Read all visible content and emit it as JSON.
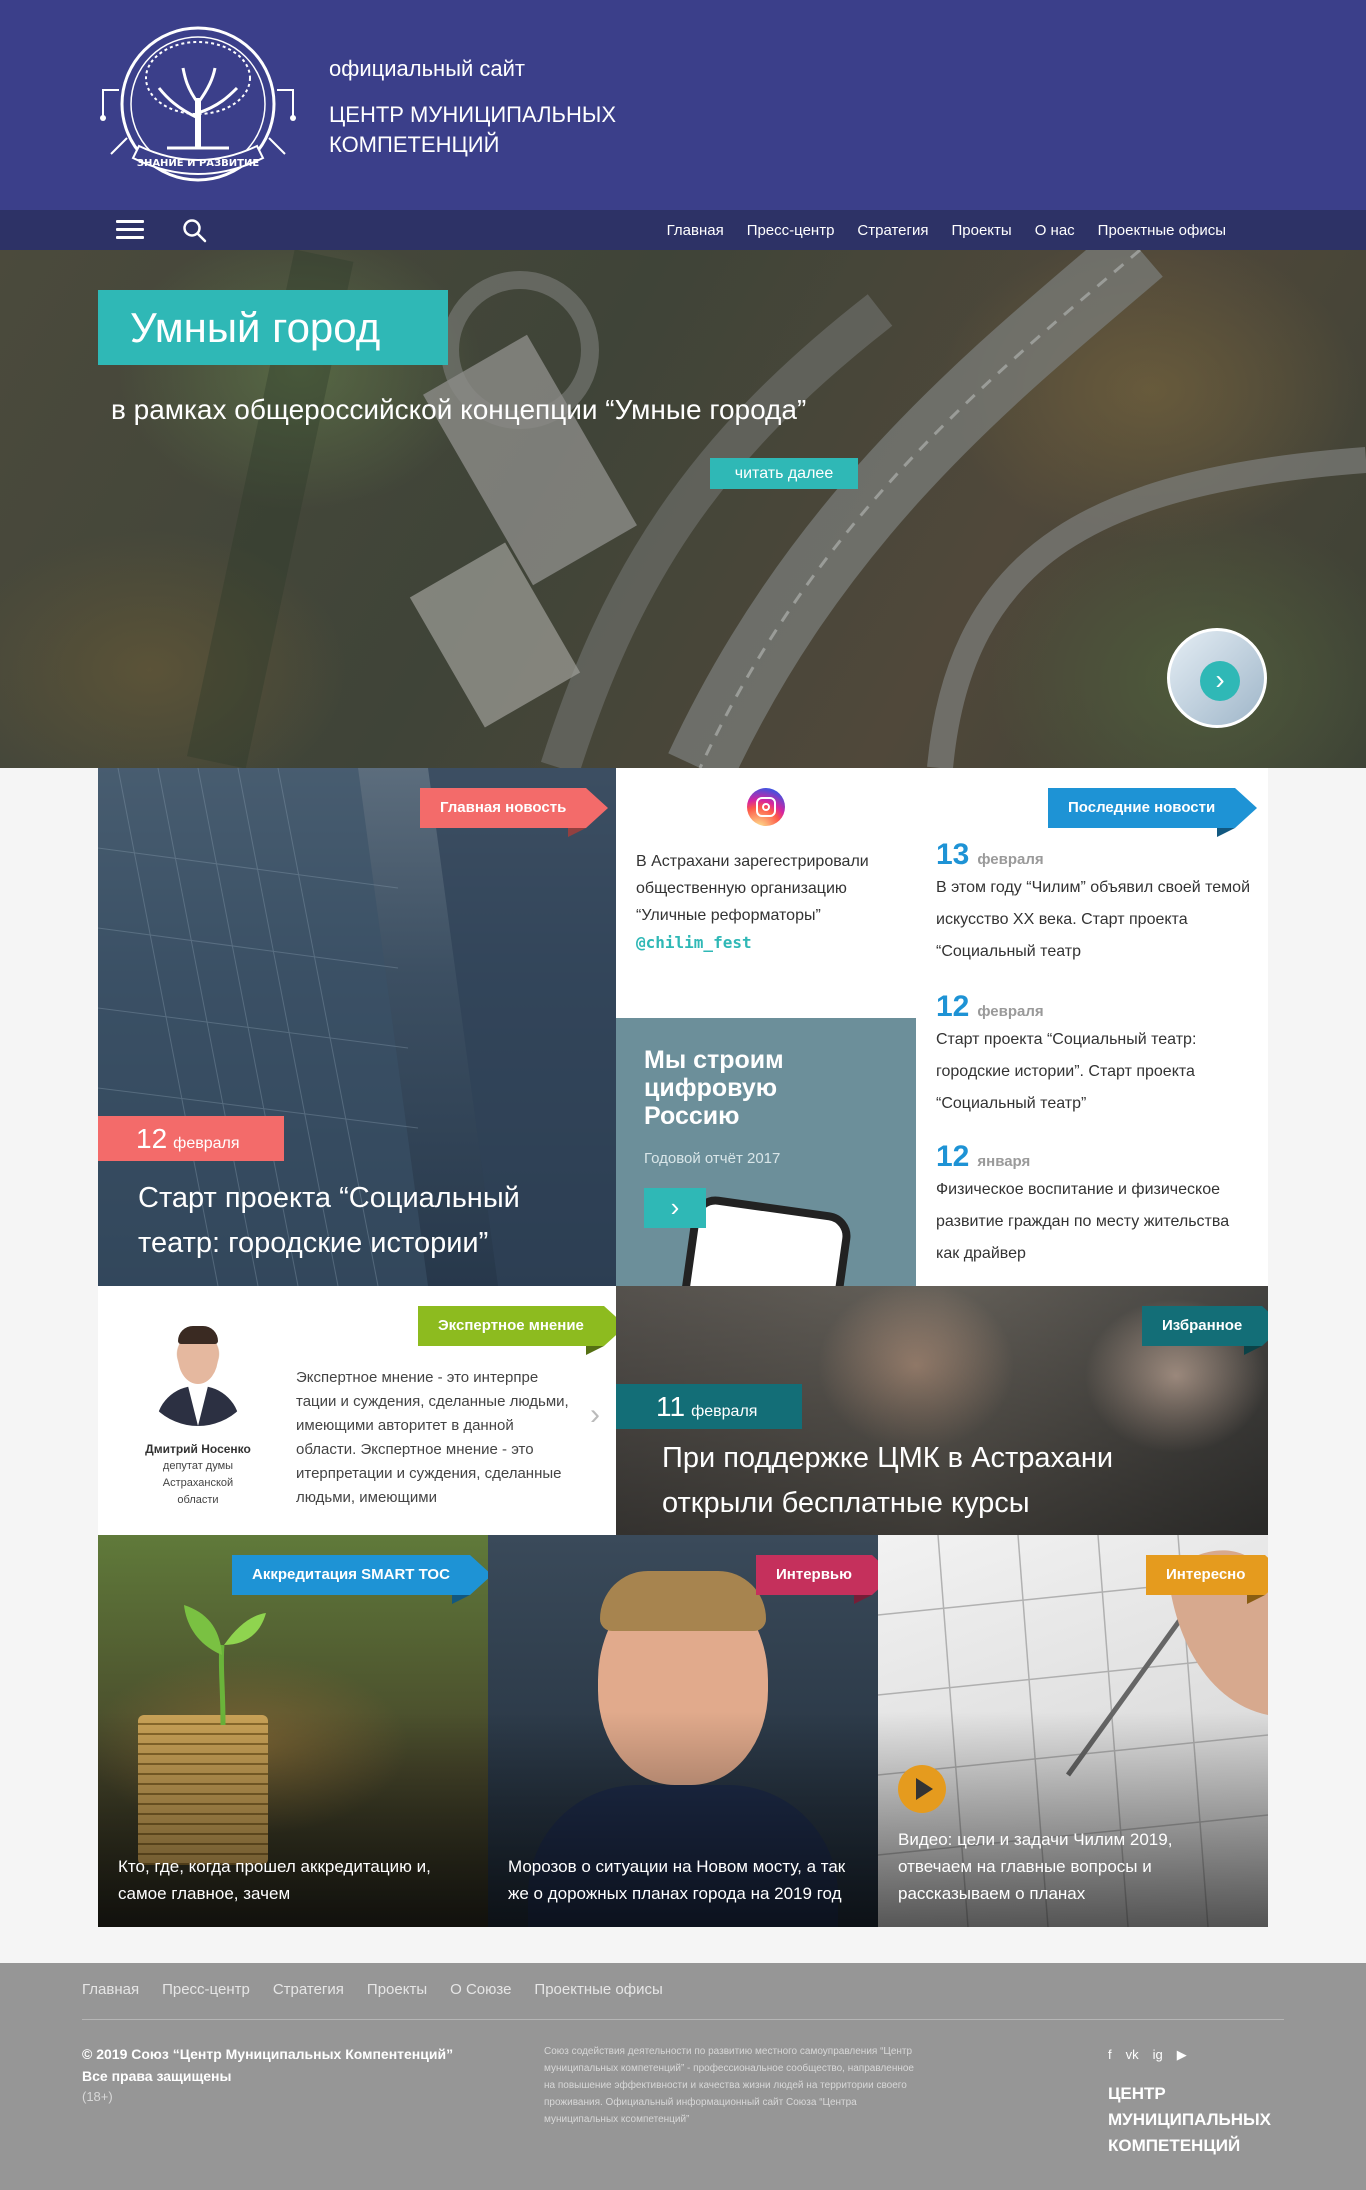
{
  "header": {
    "logo_text": "ЗНАНИЕ И РАЗВИТИЕ",
    "subtitle": "официальный сайт",
    "title": "ЦЕНТР МУНИЦИПАЛЬНЫХ КОМПЕТЕНЦИЙ"
  },
  "nav": {
    "items": [
      "Главная",
      "Пресс-центр",
      "Стратегия",
      "Проекты",
      "О нас",
      "Проектные офисы"
    ]
  },
  "hero": {
    "badge": "Умный город",
    "subtitle": "в рамках общероссийской концепции “Умные города”",
    "button": "читать далее"
  },
  "main_news": {
    "tag": "Главная новость",
    "day": "12",
    "month": "февраля",
    "headline": "Старт проекта “Социальный театр: городские истории”"
  },
  "instagram": {
    "text": "В Астрахани зарегестрировали общественную организацию “Уличные реформаторы”",
    "handle": "@chilim_fest"
  },
  "promo": {
    "title": "Мы строим цифровую Россию",
    "subtitle": "Годовой отчёт 2017",
    "button": "›"
  },
  "last_news": {
    "tag": "Последние новости",
    "items": [
      {
        "day": "13",
        "month": "февраля",
        "text": "В этом году “Чилим” объявил своей темой искусство XX века. Старт проекта “Социальный театр"
      },
      {
        "day": "12",
        "month": "февраля",
        "text": "Старт проекта “Социальный театр: городские истории”. Старт проекта “Социальный театр”"
      },
      {
        "day": "12",
        "month": "января",
        "text": "Физическое воспитание и физическое развитие граждан по месту жительства как драйвер"
      }
    ]
  },
  "expert": {
    "tag": "Экспертное мнение",
    "name": "Дмитрий Носенко",
    "role": "депутат думы Астраханской области",
    "text": "Экспертное мнение - это интерпре тации и суждения, сделанные людьми, имеющими авторитет в данной области. Экспертное мнение - это итерпретации и суждения, сделанные людьми, имеющими",
    "arrow": "›"
  },
  "favorite": {
    "tag": "Избранное",
    "day": "11",
    "month": "февраля",
    "headline": "При поддержке ЦМК в Астрахани открыли бесплатные курсы"
  },
  "cards": [
    {
      "tag": "Аккредитация SMART ТОС",
      "caption": "Кто, где, когда прошел аккредитацию и, самое главное, зачем"
    },
    {
      "tag": "Интервью",
      "caption": "Морозов о ситуации на Новом мосту, а так же о дорожных планах города на 2019 год"
    },
    {
      "tag": "Интересно",
      "caption": "Видео: цели и задачи Чилим 2019, отвечаем на главные вопросы и рассказываем о планах"
    }
  ],
  "footer": {
    "links": [
      "Главная",
      "Пресс-центр",
      "Стратегия",
      "Проекты",
      "О Союзе",
      "Проектные офисы"
    ],
    "copyright": "© 2019 Союз “Центр Муниципальных Компентенций”",
    "rights": "Все права защищены",
    "age": "(18+)",
    "description": "Союз содействия деятельности по развитию местного самоуправления “Центр муниципальных компетенций” - профессиональное сообщество, направленное на повышение эффективности и качества жизни людей на территории своего проживания. Официальный информационный сайт Союза “Центра муниципальных ксомпетенций”",
    "social": [
      "f",
      "vk",
      "ig",
      "▶"
    ],
    "brand": "ЦЕНТР МУНИЦИПАЛЬНЫХ КОМПЕТЕНЦИЙ"
  },
  "colors": {
    "header": "#3b3f8a",
    "nav": "#2d3266",
    "accent": "#2fb8b6",
    "main_news": "#f36b6a",
    "last_news": "#1e93d5",
    "expert": "#8dbb1f",
    "favorite": "#136e77",
    "interview": "#c5305c",
    "interesting": "#e59b1e",
    "footer": "#969696"
  }
}
